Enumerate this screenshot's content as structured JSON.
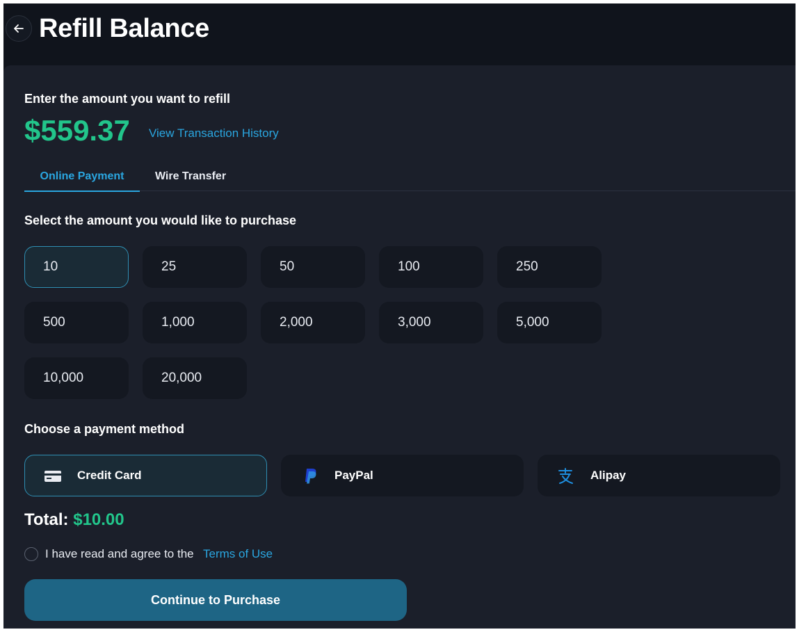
{
  "header": {
    "title": "Refill Balance",
    "back_icon": "arrow-left-icon"
  },
  "refill": {
    "prompt": "Enter the amount you want to refill",
    "balance": "$559.37",
    "history_link": "View Transaction History"
  },
  "tabs": [
    {
      "label": "Online Payment",
      "active": true
    },
    {
      "label": "Wire Transfer",
      "active": false
    }
  ],
  "amounts": {
    "label": "Select the amount you would like to purchase",
    "options": [
      "10",
      "25",
      "50",
      "100",
      "250",
      "500",
      "1,000",
      "2,000",
      "3,000",
      "5,000",
      "10,000",
      "20,000"
    ],
    "selected": "10"
  },
  "payment": {
    "label": "Choose a payment method",
    "methods": [
      {
        "label": "Credit Card",
        "icon": "credit-card-icon",
        "selected": true
      },
      {
        "label": "PayPal",
        "icon": "paypal-icon",
        "selected": false
      },
      {
        "label": "Alipay",
        "icon": "alipay-icon",
        "selected": false
      }
    ]
  },
  "total": {
    "label": "Total:",
    "value": "$10.00"
  },
  "agreement": {
    "text": "I have read and agree to the",
    "link": "Terms of Use",
    "checked": false
  },
  "cta": {
    "label": "Continue to Purchase"
  },
  "colors": {
    "accent_green": "#22c58b",
    "accent_blue": "#2aa6e0",
    "button": "#1e6585",
    "panel": "#1b1f2a"
  }
}
